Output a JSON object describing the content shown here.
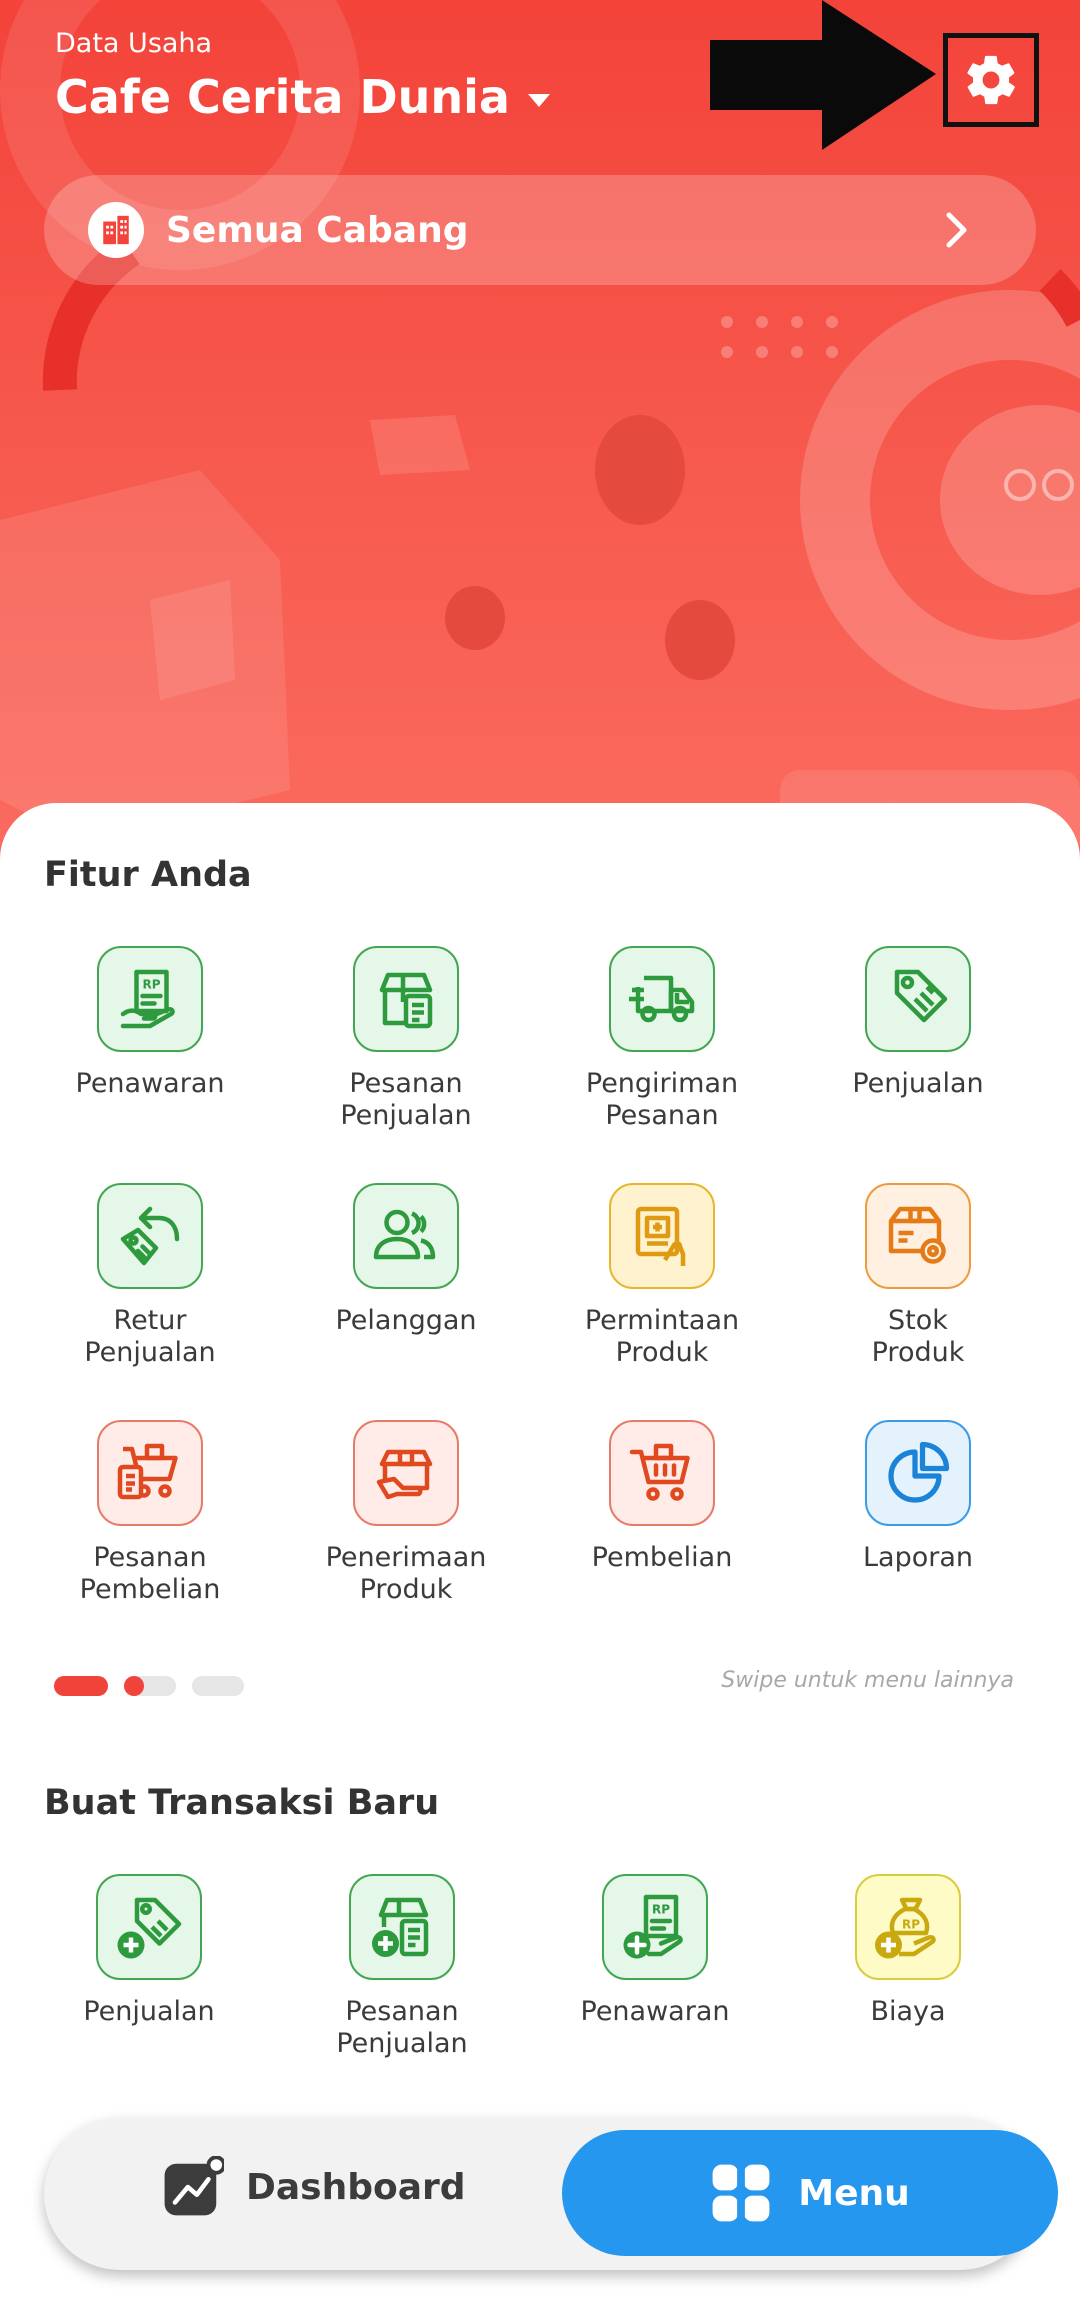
{
  "header": {
    "business_label": "Data Usaha",
    "business_name": "Cafe Cerita Dunia",
    "branch_label": "Semua Cabang"
  },
  "features": {
    "title": "Fitur Anda",
    "items": [
      {
        "label": "Penawaran",
        "icon": "quotation-icon",
        "color": "green"
      },
      {
        "label": "Pesanan\nPenjualan",
        "icon": "sales-order-icon",
        "color": "green"
      },
      {
        "label": "Pengiriman\nPesanan",
        "icon": "delivery-truck-icon",
        "color": "green"
      },
      {
        "label": "Penjualan",
        "icon": "price-tag-icon",
        "color": "green"
      },
      {
        "label": "Retur\nPenjualan",
        "icon": "sales-return-icon",
        "color": "green"
      },
      {
        "label": "Pelanggan",
        "icon": "customers-icon",
        "color": "green"
      },
      {
        "label": "Permintaan\nProduk",
        "icon": "product-request-icon",
        "color": "yellow"
      },
      {
        "label": "Stok\nProduk",
        "icon": "product-stock-icon",
        "color": "orange"
      },
      {
        "label": "Pesanan Pembelian",
        "icon": "purchase-order-icon",
        "color": "red"
      },
      {
        "label": "Penerimaan\nProduk",
        "icon": "product-receipt-icon",
        "color": "red"
      },
      {
        "label": "Pembelian",
        "icon": "shopping-cart-icon",
        "color": "red"
      },
      {
        "label": "Laporan",
        "icon": "pie-chart-icon",
        "color": "blue"
      }
    ],
    "swipe_hint": "Swipe untuk menu lainnya"
  },
  "transactions": {
    "title": "Buat Transaksi Baru",
    "items": [
      {
        "label": "Penjualan",
        "icon": "add-sale-icon",
        "color": "green"
      },
      {
        "label": "Pesanan\nPenjualan",
        "icon": "add-sales-order-icon",
        "color": "green"
      },
      {
        "label": "Penawaran",
        "icon": "add-quotation-icon",
        "color": "green"
      },
      {
        "label": "Biaya",
        "icon": "add-expense-icon",
        "color": "lime"
      }
    ]
  },
  "nav": {
    "dashboard_label": "Dashboard",
    "menu_label": "Menu"
  },
  "colors": {
    "header_red": "#f3433a",
    "icon_green": "#2e9a3e",
    "menu_blue": "#2697ee"
  }
}
